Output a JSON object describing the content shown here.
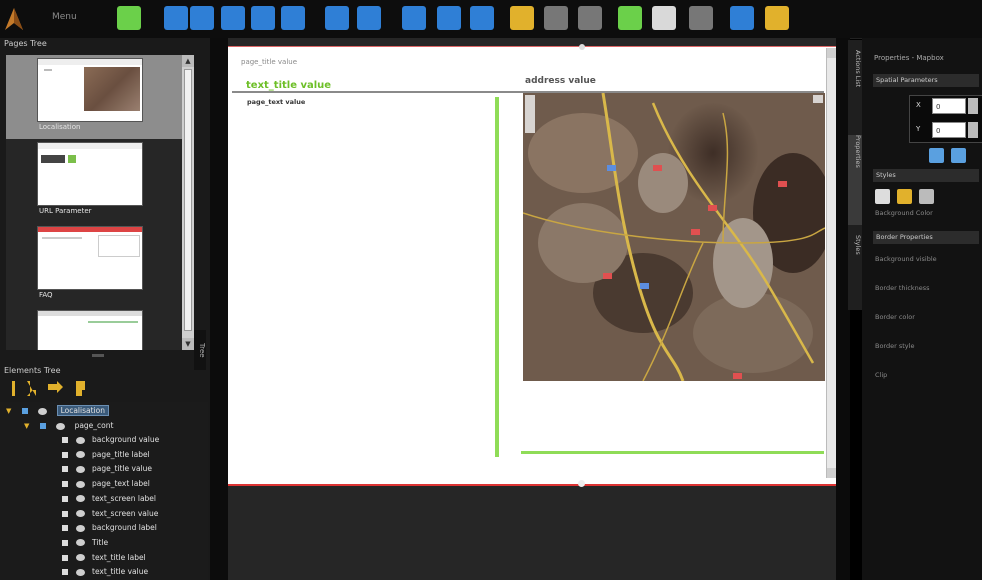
{
  "toolbar": {
    "menu_label": "Menu",
    "buttons": [
      {
        "name": "tools-icon",
        "color": "#6bd04a"
      },
      {
        "name": "edit-icon",
        "color": "#2f7fd6"
      },
      {
        "name": "save-icon",
        "color": "#2f7fd6"
      },
      {
        "name": "copy-page-icon",
        "color": "#2f7fd6"
      },
      {
        "name": "export-icon",
        "color": "#2f7fd6"
      },
      {
        "name": "document-icon",
        "color": "#2f7fd6"
      },
      {
        "name": "sync-icon",
        "color": "#2f7fd6"
      },
      {
        "name": "camera-icon",
        "color": "#2f7fd6"
      },
      {
        "name": "text-box-icon",
        "color": "#2f7fd6"
      },
      {
        "name": "input-box-icon",
        "color": "#2f7fd6"
      },
      {
        "name": "computer-icon",
        "color": "#2f7fd6"
      },
      {
        "name": "cut-icon",
        "color": "#e1b12c"
      },
      {
        "name": "paste-icon",
        "color": "#777777"
      },
      {
        "name": "trash-icon",
        "color": "#777777"
      },
      {
        "name": "add-element-icon",
        "color": "#6bd04a"
      },
      {
        "name": "duplicate-icon",
        "color": "#d9d9d9"
      },
      {
        "name": "clipboard-icon",
        "color": "#777777"
      },
      {
        "name": "layout-icon",
        "color": "#2f7fd6"
      },
      {
        "name": "publish-icon",
        "color": "#e1b12c"
      }
    ]
  },
  "pages_tree": {
    "title": "Pages Tree",
    "pages": [
      {
        "label": "Localisation",
        "selected": true
      },
      {
        "label": "URL Parameter",
        "selected": false
      },
      {
        "label": "FAQ",
        "selected": false
      },
      {
        "label": "",
        "selected": false
      }
    ]
  },
  "tree_tab_label": "Tree",
  "elements_tree": {
    "title": "Elements Tree",
    "root": "Localisation",
    "group": "page_cont",
    "items": [
      "background value",
      "page_title label",
      "page_title value",
      "page_text label",
      "text_screen label",
      "text_screen value",
      "background label",
      "Title",
      "text_title label",
      "text_title value"
    ]
  },
  "canvas": {
    "page_title_value": "page_title value",
    "text_title_value": "text_title value",
    "address_value": "address value",
    "page_text_value": "page_text value"
  },
  "right_tabs": [
    "Actions List",
    "Properties",
    "Styles"
  ],
  "properties": {
    "title": "Properties - Mapbox",
    "position_section": "Spatial Parameters",
    "x_label": "X",
    "x_value": "0",
    "y_label": "Y",
    "y_value": "0",
    "style_section": "Styles",
    "background_color_label": "Background Color",
    "border_section": "Border Properties",
    "border_props": [
      "Background visible",
      "Border thickness",
      "Border color",
      "Border style",
      "Clip"
    ]
  },
  "colors": {
    "accent_green": "#6dbf27",
    "selection_blue": "#3a5a7a"
  }
}
